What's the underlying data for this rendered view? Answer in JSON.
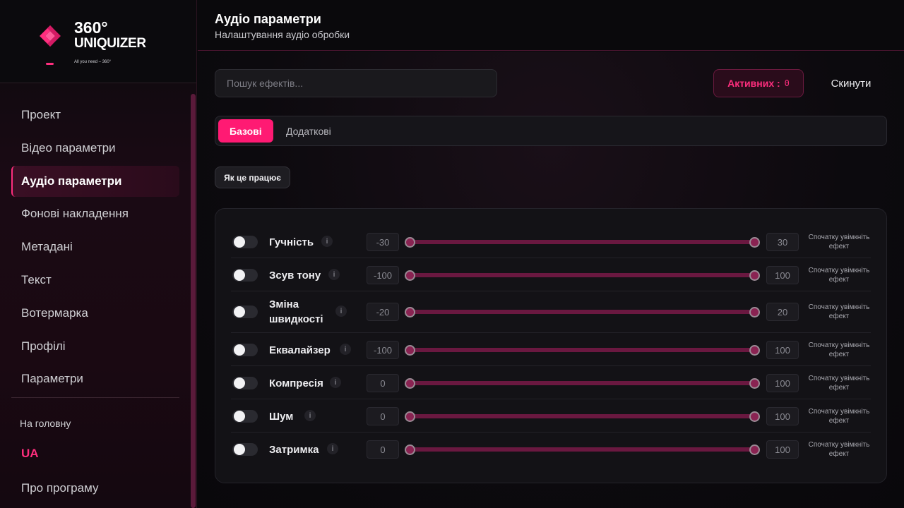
{
  "app": {
    "logo_number": "360°",
    "logo_name": "UNIQUIZER",
    "logo_tagline": "All you need – 360°"
  },
  "sidebar": {
    "items": [
      {
        "label": "Проект"
      },
      {
        "label": "Відео параметри"
      },
      {
        "label": "Аудіо параметри",
        "active": true
      },
      {
        "label": "Фонові накладення"
      },
      {
        "label": "Метадані"
      },
      {
        "label": "Текст"
      },
      {
        "label": "Вотермарка"
      },
      {
        "label": "Профілі"
      },
      {
        "label": "Параметри"
      }
    ],
    "home_label": "На головну",
    "lang_label": "UA",
    "about_label": "Про програму"
  },
  "header": {
    "title": "Аудіо параметри",
    "subtitle": "Налаштування аудіо обробки"
  },
  "toolbar": {
    "search_placeholder": "Пошук ефектів...",
    "active_label": "Активних :",
    "active_count": "0",
    "reset_label": "Скинути"
  },
  "tabs": [
    {
      "label": "Базові",
      "active": true
    },
    {
      "label": "Додаткові",
      "active": false
    }
  ],
  "howto_label": "Як це працює",
  "effects": [
    {
      "name": "Гучність",
      "min": "-30",
      "max": "30",
      "hint": "Спочатку увімкніть ефект",
      "enabled": false
    },
    {
      "name": "Зсув тону",
      "min": "-100",
      "max": "100",
      "hint": "Спочатку увімкніть ефект",
      "enabled": false
    },
    {
      "name": "Зміна швидкості",
      "min": "-20",
      "max": "20",
      "hint": "Спочатку увімкніть ефект",
      "enabled": false
    },
    {
      "name": "Еквалайзер",
      "min": "-100",
      "max": "100",
      "hint": "Спочатку увімкніть ефект",
      "enabled": false
    },
    {
      "name": "Компресія",
      "min": "0",
      "max": "100",
      "hint": "Спочатку увімкніть ефект",
      "enabled": false
    },
    {
      "name": "Шум",
      "min": "0",
      "max": "100",
      "hint": "Спочатку увімкніть ефект",
      "enabled": false
    },
    {
      "name": "Затримка",
      "min": "0",
      "max": "100",
      "hint": "Спочатку увімкніть ефект",
      "enabled": false
    }
  ],
  "info_glyph": "i",
  "colors": {
    "accent": "#ff1a73",
    "track": "#6a1840"
  }
}
